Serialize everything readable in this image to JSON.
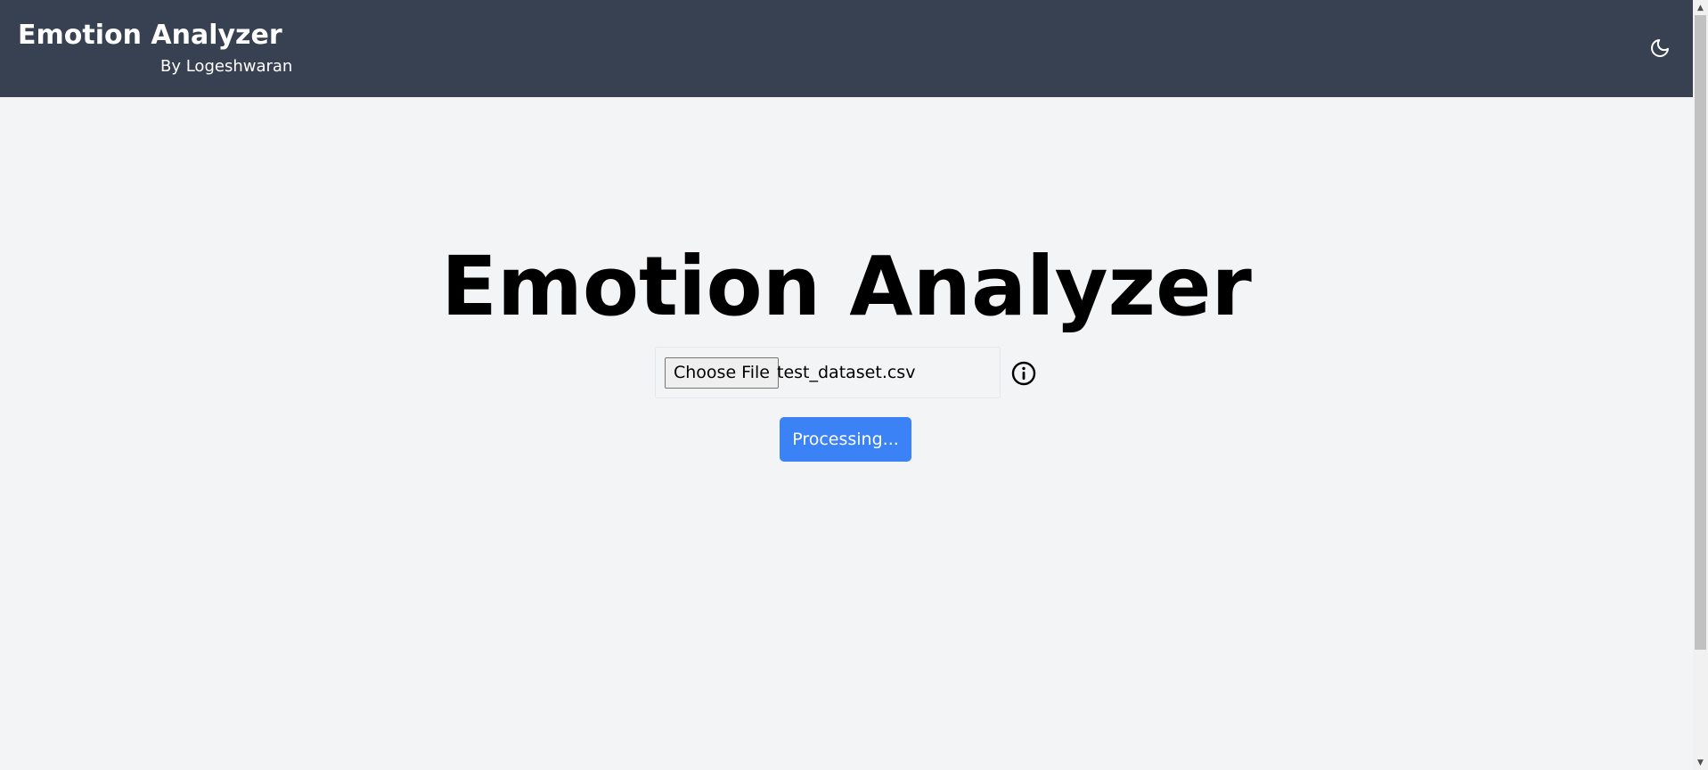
{
  "header": {
    "title": "Emotion Analyzer",
    "subtitle": "By Logeshwaran",
    "theme_toggle_icon": "moon-icon",
    "background_color": "#374151"
  },
  "main": {
    "heading": "Emotion Analyzer",
    "file_input": {
      "button_label": "Choose File",
      "selected_file": "test_dataset.csv"
    },
    "info_icon": "info-icon",
    "submit_button": {
      "label": "Processing...",
      "color": "#3b82f6"
    }
  },
  "scrollbar": {
    "up_icon": "scroll-up-arrow-icon",
    "down_icon": "scroll-down-arrow-icon"
  }
}
